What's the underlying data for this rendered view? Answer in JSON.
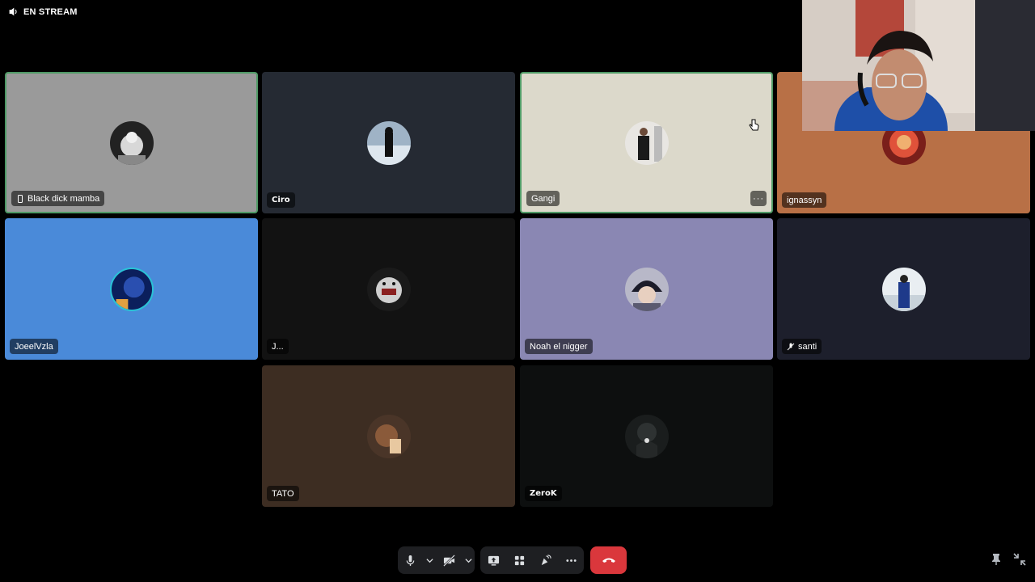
{
  "stream_label": "EN STREAM",
  "tiles": [
    {
      "name": "Black dick mamba",
      "bg": "#9a9a9a",
      "speaking": true,
      "icon": "mobile-icon"
    },
    {
      "name": "Ciro",
      "bg": "#252a33",
      "speaking": false
    },
    {
      "name": "Gangi",
      "bg": "#dcd9cb",
      "speaking": true,
      "has_more": true
    },
    {
      "name": "ignassyn",
      "bg": "#b87046",
      "speaking": false
    },
    {
      "name": "JoeelVzla",
      "bg": "#4a8ad9",
      "speaking": false
    },
    {
      "name": "J...",
      "bg": "#121212",
      "speaking": false
    },
    {
      "name": "Noah el nigger",
      "bg": "#8a87b3",
      "speaking": false
    },
    {
      "name": "santi",
      "bg": "#1d1f2c",
      "speaking": false,
      "icon": "muted-mic-icon"
    },
    {
      "name": "TATO",
      "bg": "#3d2d22",
      "speaking": false
    },
    {
      "name": "ZeroK",
      "bg": "#0d0f0f",
      "speaking": false
    }
  ],
  "more_label": "···",
  "colors": {
    "speaking_border": "#4f9a66",
    "hangup": "#da373c",
    "control_bg": "#1e1f22"
  },
  "controls": [
    "microphone-icon",
    "chevron-down-icon",
    "camera-off-icon",
    "chevron-down-icon",
    "screen-share-icon",
    "activities-icon",
    "soundboard-icon",
    "more-options-icon",
    "hang-up-icon"
  ],
  "corner_icons": [
    "pin-icon",
    "collapse-icon"
  ]
}
